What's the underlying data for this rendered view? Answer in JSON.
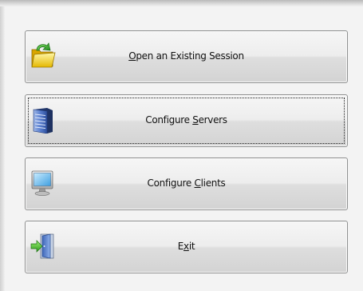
{
  "buttons": {
    "open_session": {
      "pre": "",
      "mnemonic": "O",
      "post": "pen an Existing Session",
      "icon": "open-folder-icon"
    },
    "configure_servers": {
      "pre": "Configure ",
      "mnemonic": "S",
      "post": "ervers",
      "icon": "server-icon"
    },
    "configure_clients": {
      "pre": "Configure ",
      "mnemonic": "C",
      "post": "lients",
      "icon": "monitor-icon"
    },
    "exit": {
      "pre": "E",
      "mnemonic": "x",
      "post": "it",
      "icon": "exit-door-icon"
    }
  },
  "focused_button": "configure_servers"
}
